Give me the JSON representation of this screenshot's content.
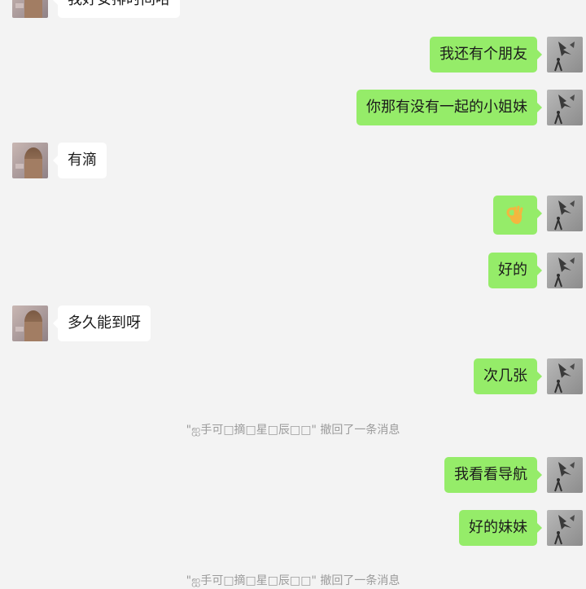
{
  "messages": [
    {
      "side": "left",
      "text": "我好安排时间哈"
    },
    {
      "side": "right",
      "text": "我还有个朋友"
    },
    {
      "side": "right",
      "text": "你那有没有一起的小姐妹"
    },
    {
      "side": "left",
      "text": "有滴"
    },
    {
      "side": "right",
      "icon": "ok-hand-emoji-icon"
    },
    {
      "side": "right",
      "text": "好的"
    },
    {
      "side": "left",
      "text": "多久能到呀"
    },
    {
      "side": "right",
      "text": "次几张"
    },
    {
      "system": "\"ஐ手可□摘□星□辰□□\" 撤回了一条消息"
    },
    {
      "side": "right",
      "text": "我看看导航"
    },
    {
      "side": "right",
      "text": "好的妹妹"
    },
    {
      "system": "\"ஐ手可□摘□星□辰□□\" 撤回了一条消息"
    }
  ],
  "colors": {
    "background": "#f3f3f3",
    "outgoing_bubble": "#95ec69",
    "incoming_bubble": "#ffffff",
    "system_text": "#9b9b9b"
  }
}
